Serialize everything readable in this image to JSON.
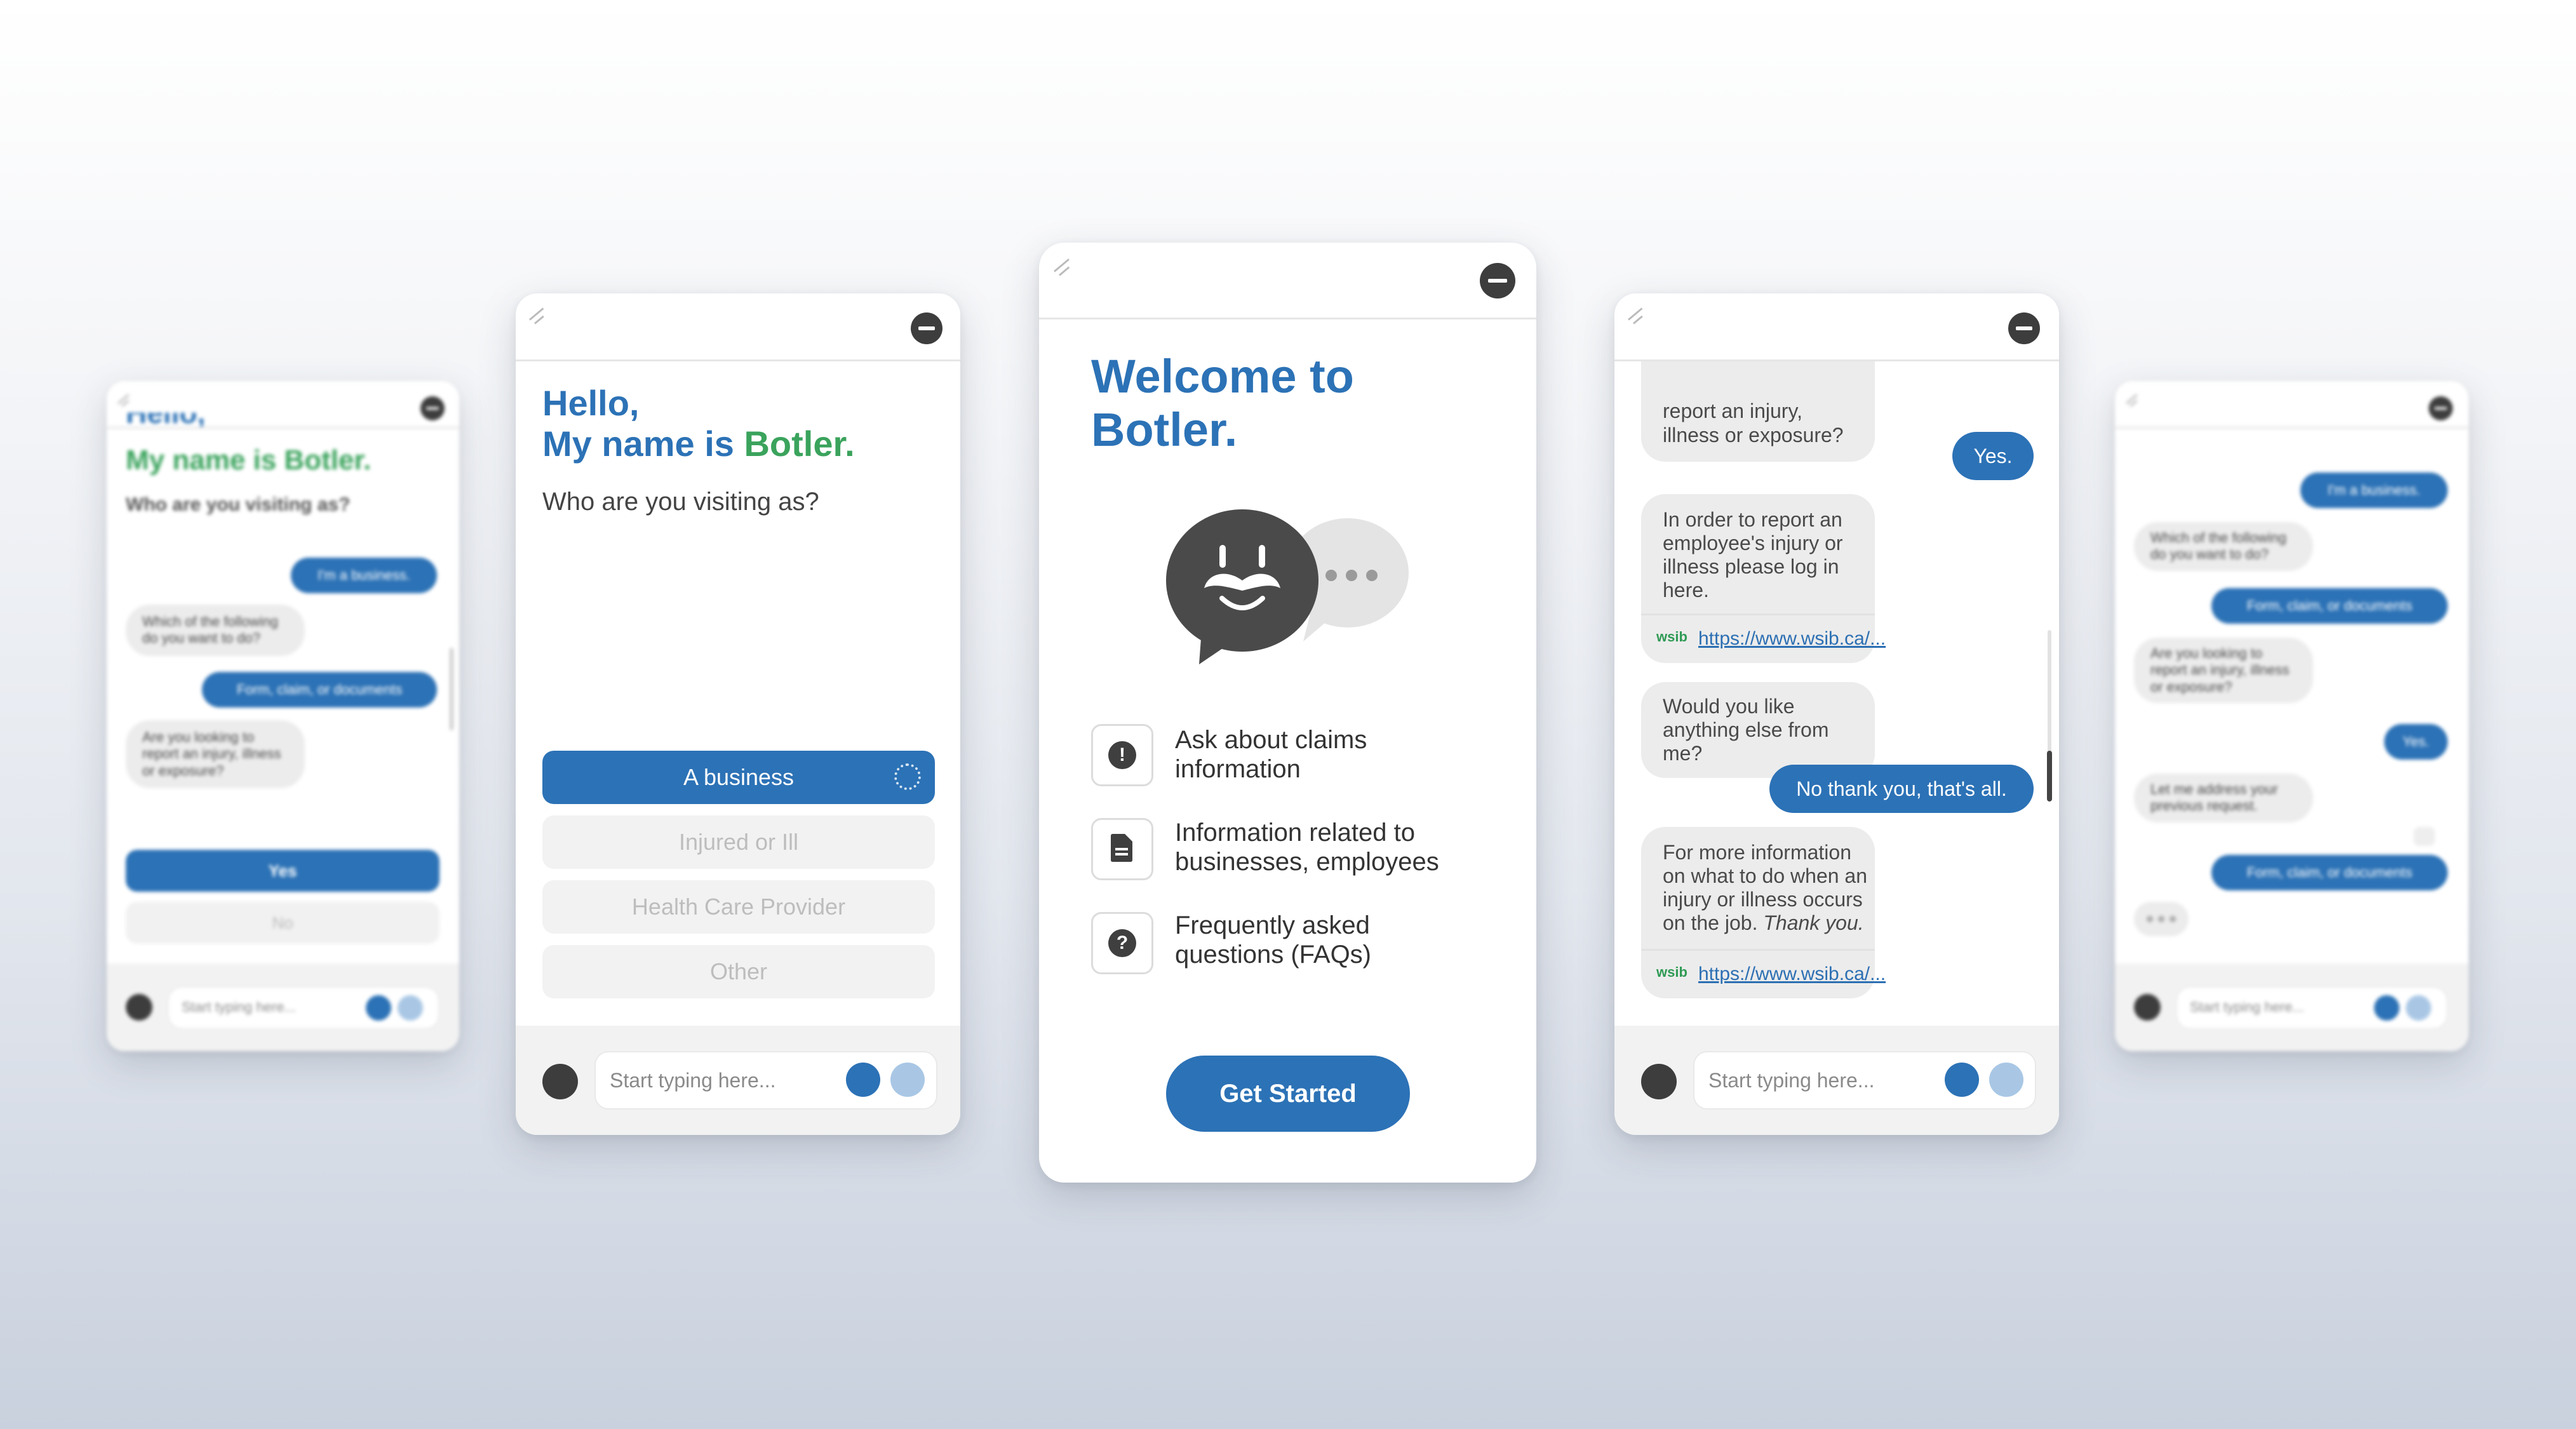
{
  "colors": {
    "brand_blue": "#2c72b6",
    "brand_green": "#3aa35c",
    "dark": "#3d3d3d",
    "bubble": "#ececec"
  },
  "input": {
    "placeholder": "Start typing here..."
  },
  "icons": {
    "grip": "resize-grip-icon",
    "close": "minus-circle-icon",
    "undo": "undo-icon",
    "mic": "microphone-icon",
    "send": "send-arrow-icon",
    "bot": "botler-mustache-face-icon"
  },
  "screen1": {
    "cut_heading": "Hello,",
    "greeting": "My name is Botler.",
    "question": "Who are you visiting as?",
    "messages": [
      {
        "role": "user",
        "text": "I'm a business."
      },
      {
        "role": "bot",
        "text": "Which of the following do you want to do?"
      },
      {
        "role": "user",
        "text": "Form, claim, or documents"
      },
      {
        "role": "bot",
        "text": "Are you looking to report an injury, illness or exposure?"
      }
    ],
    "options": [
      "Yes",
      "No"
    ]
  },
  "screen2": {
    "hello": "Hello,",
    "name_prefix": "My name is ",
    "name": "Botler.",
    "question": "Who are you visiting as?",
    "options": [
      "A business",
      "Injured or Ill",
      "Health Care Provider",
      "Other"
    ]
  },
  "screen3": {
    "title_blue": "Welcome to",
    "title_green": "Botler.",
    "features": [
      {
        "icon": "exclamation-icon",
        "text": "Ask about claims information"
      },
      {
        "icon": "document-icon",
        "text": "Information related to businesses, employees"
      },
      {
        "icon": "question-icon",
        "text": "Frequently asked questions (FAQs)"
      }
    ],
    "cta": "Get Started"
  },
  "screen4": {
    "cut_bot": "report an injury, illness or exposure?",
    "yes": "Yes.",
    "bot_login": "In order to report an employee's injury or illness please log in here.",
    "link_logo": "wsib",
    "link": "https://www.wsib.ca/...",
    "bot_more": "Would you like anything else from me?",
    "user_done": "No thank you, that's all.",
    "bot_info": "For more information on what to do when an injury or illness occurs on the job.",
    "bot_info_thanks": "Thank you."
  },
  "screen5": {
    "messages": [
      {
        "role": "user",
        "text": "I'm a business."
      },
      {
        "role": "bot",
        "text": "Which of the following do you want to do?"
      },
      {
        "role": "user",
        "text": "Form, claim, or documents"
      },
      {
        "role": "bot",
        "text": "Are you looking to report an injury, illness or exposure?"
      },
      {
        "role": "user",
        "text": "Yes."
      },
      {
        "role": "bot",
        "text": "Let me address your previous request."
      },
      {
        "role": "user",
        "text": "Form, claim, or documents"
      }
    ]
  }
}
